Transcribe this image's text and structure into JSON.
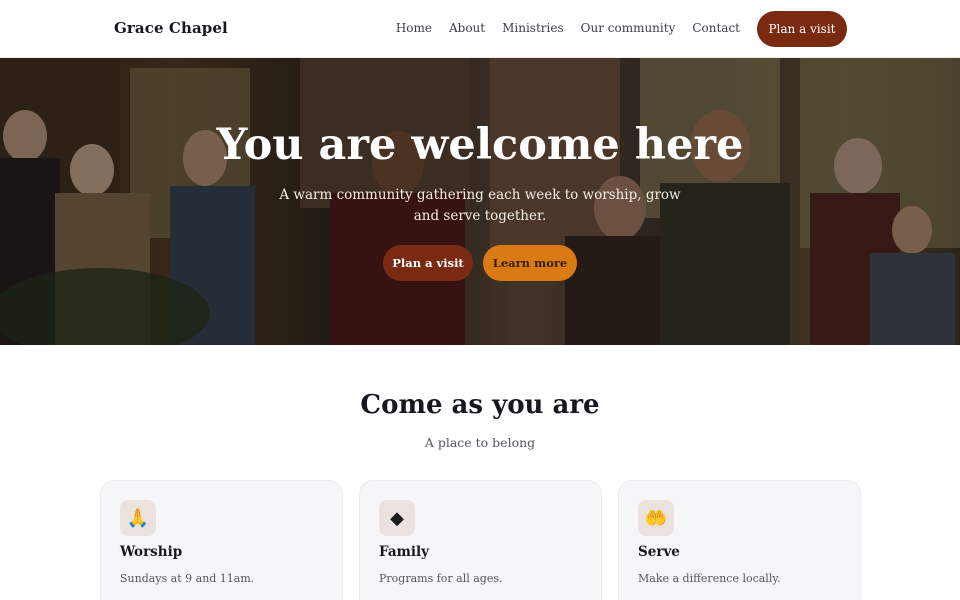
{
  "nav": {
    "brand": "Grace Chapel",
    "links": [
      "Home",
      "About",
      "Ministries",
      "Our community",
      "Contact"
    ],
    "cta": "Plan a visit"
  },
  "hero": {
    "title": "You are welcome here",
    "subtitle": "A warm community gathering each week to worship, grow and serve together.",
    "primary_button": "Plan a visit",
    "secondary_button": "Learn more"
  },
  "section": {
    "title": "Come as you are",
    "subtitle": "A place to belong"
  },
  "cards": [
    {
      "icon": "🙏",
      "icon_name": "praying-hands-icon",
      "title": "Worship",
      "text": "Sundays at 9 and 11am."
    },
    {
      "icon": "◆",
      "icon_name": "diamond-icon",
      "title": "Family",
      "text": "Programs for all ages."
    },
    {
      "icon": "🤲",
      "icon_name": "open-hands-icon",
      "title": "Serve",
      "text": "Make a difference locally."
    }
  ],
  "colors": {
    "primary": "#7a2a10",
    "accent": "#d97b12"
  }
}
